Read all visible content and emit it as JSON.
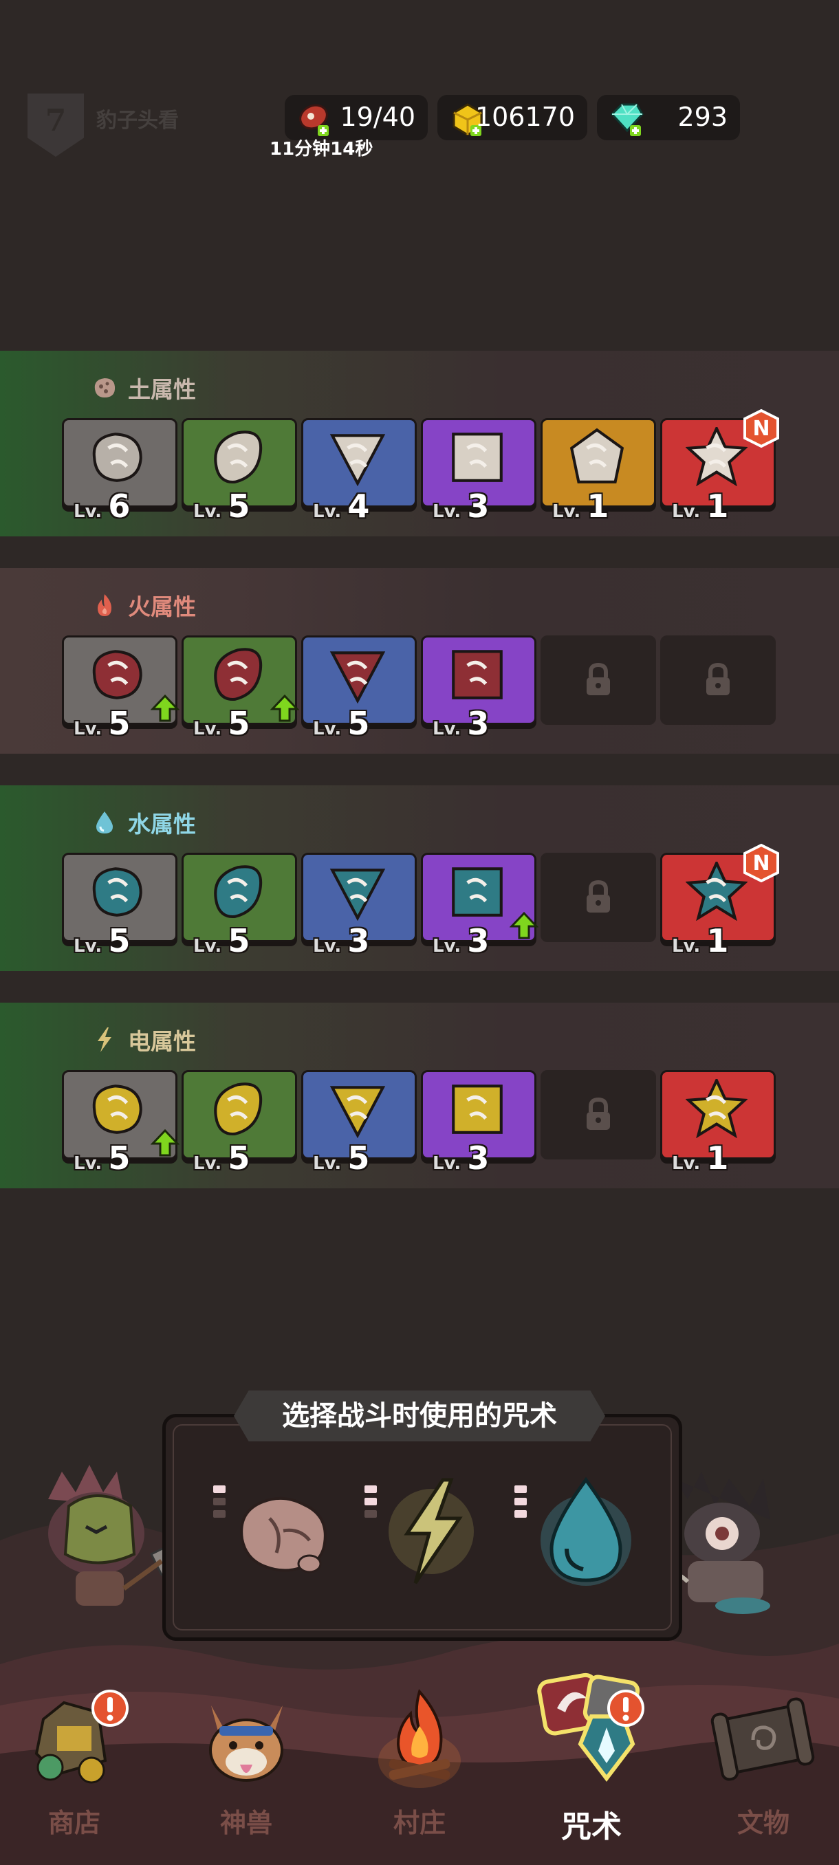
{
  "profile": {
    "level": "7",
    "name": "豹子头看"
  },
  "resources": {
    "meat": "19/40",
    "gold": "106170",
    "gems": "293",
    "meat_timer": "11分钟14秒"
  },
  "sections": [
    {
      "title": "土属性",
      "cards": [
        {
          "color": "gray",
          "lv": "6"
        },
        {
          "color": "green",
          "lv": "5"
        },
        {
          "color": "blue",
          "lv": "4"
        },
        {
          "color": "purple",
          "lv": "3"
        },
        {
          "color": "orange",
          "lv": "1"
        },
        {
          "color": "red",
          "lv": "1",
          "badge": "N"
        }
      ]
    },
    {
      "title": "火属性",
      "cards": [
        {
          "color": "gray",
          "lv": "5",
          "upgrade": true
        },
        {
          "color": "green",
          "lv": "5",
          "upgrade": true
        },
        {
          "color": "blue",
          "lv": "5"
        },
        {
          "color": "purple",
          "lv": "3"
        },
        {
          "locked": true
        },
        {
          "locked": true
        }
      ]
    },
    {
      "title": "水属性",
      "cards": [
        {
          "color": "gray",
          "lv": "5"
        },
        {
          "color": "green",
          "lv": "5"
        },
        {
          "color": "blue",
          "lv": "3"
        },
        {
          "color": "purple",
          "lv": "3",
          "upgrade": true
        },
        {
          "locked": true
        },
        {
          "color": "red",
          "lv": "1",
          "badge": "N"
        }
      ]
    },
    {
      "title": "电属性",
      "cards": [
        {
          "color": "gray",
          "lv": "5",
          "upgrade": true
        },
        {
          "color": "green",
          "lv": "5"
        },
        {
          "color": "blue",
          "lv": "5"
        },
        {
          "color": "purple",
          "lv": "3"
        },
        {
          "locked": true
        },
        {
          "color": "red",
          "lv": "1"
        }
      ]
    }
  ],
  "lv_prefix": "Lv.",
  "badge_new": "N",
  "spell_panel": {
    "title": "选择战斗时使用的咒术",
    "slots": [
      {
        "element": "earth",
        "icon": "rock-icon",
        "level_dots": 1
      },
      {
        "element": "electric",
        "icon": "lightning-icon",
        "level_dots": 2
      },
      {
        "element": "water",
        "icon": "water-drop-icon",
        "level_dots": 3
      }
    ]
  },
  "nav": [
    {
      "label": "商店",
      "icon": "shop-icon",
      "alert": true
    },
    {
      "label": "神兽",
      "icon": "beast-icon"
    },
    {
      "label": "村庄",
      "icon": "campfire-icon"
    },
    {
      "label": "咒术",
      "icon": "spell-icon",
      "alert": true,
      "active": true
    },
    {
      "label": "文物",
      "icon": "scroll-icon"
    }
  ],
  "colors": {
    "gray": "#6f6b69",
    "green": "#4f7a37",
    "blue": "#4a63a8",
    "purple": "#8644c6",
    "orange": "#c88a22",
    "red": "#cc3535",
    "badge": "#e4532f",
    "upgrade_arrow": "#7fd61e"
  }
}
